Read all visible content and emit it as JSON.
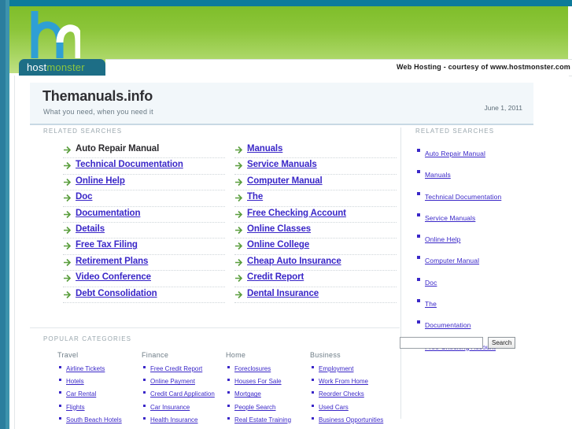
{
  "browser": {
    "accent_teal": "#0d7b9a",
    "accent_green": "#8cc63f",
    "link_color": "#3a27c8"
  },
  "header": {
    "logo_text_host": "host",
    "logo_text_monster": "monster",
    "courtesy": "Web Hosting - courtesy of www.hostmonster.com"
  },
  "title_block": {
    "title": "Themanuals.info",
    "tagline": "What you need, when you need it",
    "date": "June 1, 2011"
  },
  "main": {
    "section_label": "RELATED SEARCHES",
    "column_left": [
      "Auto Repair Manual",
      "Technical Documentation",
      "Online Help",
      "Doc",
      "Documentation",
      "Details",
      "Free Tax Filing",
      "Retirement Plans",
      "Video Conference",
      "Debt Consolidation"
    ],
    "column_right": [
      "Manuals",
      "Service Manuals",
      "Computer Manual",
      "The",
      "Free Checking Account",
      "Online Classes",
      "Online College",
      "Cheap Auto Insurance",
      "Credit Report",
      "Dental Insurance"
    ]
  },
  "sidebar": {
    "section_label": "RELATED SEARCHES",
    "items": [
      "Auto Repair Manual",
      "Manuals",
      "Technical Documentation",
      "Service Manuals",
      "Online Help",
      "Computer Manual",
      "Doc",
      "The",
      "Documentation",
      "Free Checking Account"
    ],
    "search": {
      "value": "",
      "placeholder": "",
      "button_label": "Search"
    }
  },
  "popular": {
    "section_label": "POPULAR CATEGORIES",
    "categories": [
      {
        "name": "Travel",
        "items": [
          "Airline Tickets",
          "Hotels",
          "Car Rental",
          "Flights",
          "South Beach Hotels"
        ]
      },
      {
        "name": "Finance",
        "items": [
          "Free Credit Report",
          "Online Payment",
          "Credit Card Application",
          "Car Insurance",
          "Health Insurance"
        ]
      },
      {
        "name": "Home",
        "items": [
          "Foreclosures",
          "Houses For Sale",
          "Mortgage",
          "People Search",
          "Real Estate Training"
        ]
      },
      {
        "name": "Business",
        "items": [
          "Employment",
          "Work From Home",
          "Reorder Checks",
          "Used Cars",
          "Business Opportunities"
        ]
      }
    ]
  }
}
